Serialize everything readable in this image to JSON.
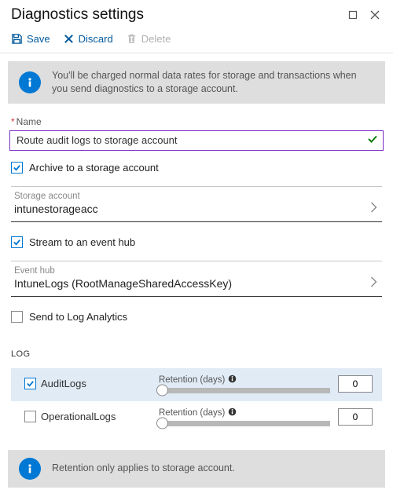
{
  "window": {
    "title": "Diagnostics settings"
  },
  "toolbar": {
    "save_label": "Save",
    "discard_label": "Discard",
    "delete_label": "Delete"
  },
  "banner_top": {
    "message": "You'll be charged normal data rates for storage and transactions when you send diagnostics to a storage account."
  },
  "name_field": {
    "label": "Name",
    "value": "Route audit logs to storage account"
  },
  "options": {
    "archive_label": "Archive to a storage account",
    "archive_checked": true,
    "stream_label": "Stream to an event hub",
    "stream_checked": true,
    "log_analytics_label": "Send to Log Analytics",
    "log_analytics_checked": false
  },
  "storage_picker": {
    "label": "Storage account",
    "value": "intunestorageacc"
  },
  "eventhub_picker": {
    "label": "Event hub",
    "value": "IntuneLogs (RootManageSharedAccessKey)"
  },
  "log_section": {
    "heading": "LOG",
    "retention_label": "Retention (days)",
    "rows": [
      {
        "name": "AuditLogs",
        "checked": true,
        "retention": "0"
      },
      {
        "name": "OperationalLogs",
        "checked": false,
        "retention": "0"
      }
    ]
  },
  "banner_bottom": {
    "message": "Retention only applies to storage account."
  }
}
